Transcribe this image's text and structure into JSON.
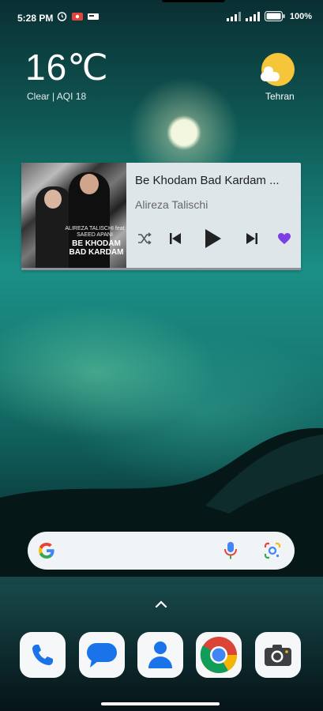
{
  "status": {
    "time": "5:28 PM",
    "battery": "100%",
    "icons": [
      "alarm-icon",
      "screen-record-icon",
      "vpn-icon",
      "signal-icon",
      "wifi-icon",
      "battery-icon"
    ]
  },
  "weather": {
    "temperature": "16℃",
    "condition": "Clear | AQI 18",
    "city": "Tehran",
    "icon": "partly-sunny-icon"
  },
  "music": {
    "title": "Be Khodam Bad Kardam ...",
    "artist": "Alireza Talischi",
    "cover_line1": "ALIREZA TALISCHI feat SAEED APANI",
    "cover_line2": "BE KHODAM BAD KARDAM",
    "progress": 1.0,
    "controls": [
      "shuffle-icon",
      "previous-icon",
      "play-icon",
      "next-icon",
      "heart-icon"
    ],
    "accent": "#7b3fe4"
  },
  "search": {
    "placeholder": "",
    "logo": "G"
  },
  "dock": {
    "apps": [
      {
        "name": "Phone"
      },
      {
        "name": "Messages"
      },
      {
        "name": "Contacts"
      },
      {
        "name": "Chrome"
      },
      {
        "name": "Camera"
      }
    ]
  }
}
